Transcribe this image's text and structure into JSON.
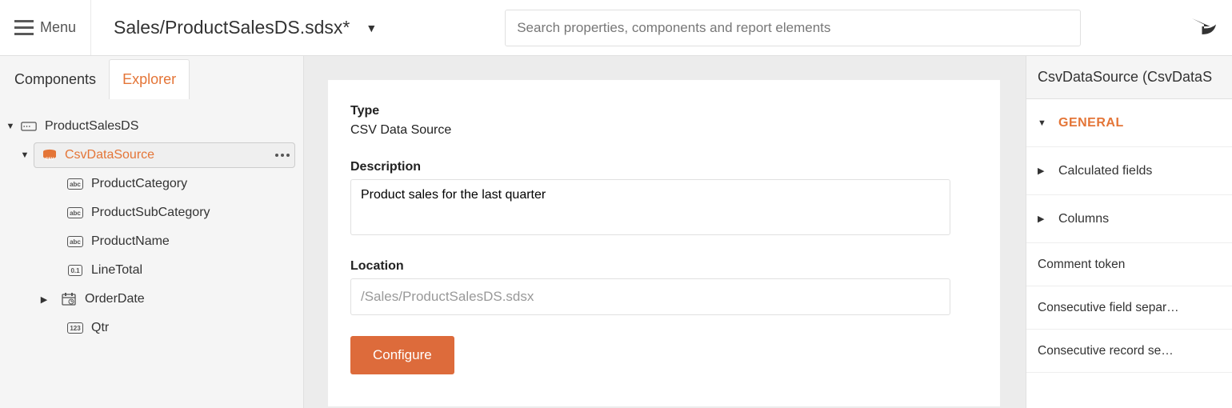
{
  "header": {
    "menu_label": "Menu",
    "filename": "Sales/ProductSalesDS.sdsx*",
    "search_placeholder": "Search properties, components and report elements"
  },
  "tabs": {
    "components": "Components",
    "explorer": "Explorer"
  },
  "tree": {
    "root": "ProductSalesDS",
    "csv_node": "CsvDataSource",
    "fields": [
      {
        "label": "ProductCategory",
        "type": "abc"
      },
      {
        "label": "ProductSubCategory",
        "type": "abc"
      },
      {
        "label": "ProductName",
        "type": "abc"
      },
      {
        "label": "LineTotal",
        "type": "0.1"
      },
      {
        "label": "OrderDate",
        "type": "date"
      },
      {
        "label": "Qtr",
        "type": "123"
      }
    ]
  },
  "center": {
    "type_label": "Type",
    "type_value": "CSV Data Source",
    "description_label": "Description",
    "description_value": "Product sales for the last quarter",
    "location_label": "Location",
    "location_value": "/Sales/ProductSalesDS.sdsx",
    "configure_label": "Configure"
  },
  "right": {
    "title": "CsvDataSource (CsvDataS",
    "sections": {
      "general": "GENERAL",
      "calc": "Calculated fields",
      "columns": "Columns"
    },
    "props": {
      "comment_token": "Comment token",
      "consec_field": "Consecutive field separ…",
      "consec_record": "Consecutive record se…"
    }
  }
}
